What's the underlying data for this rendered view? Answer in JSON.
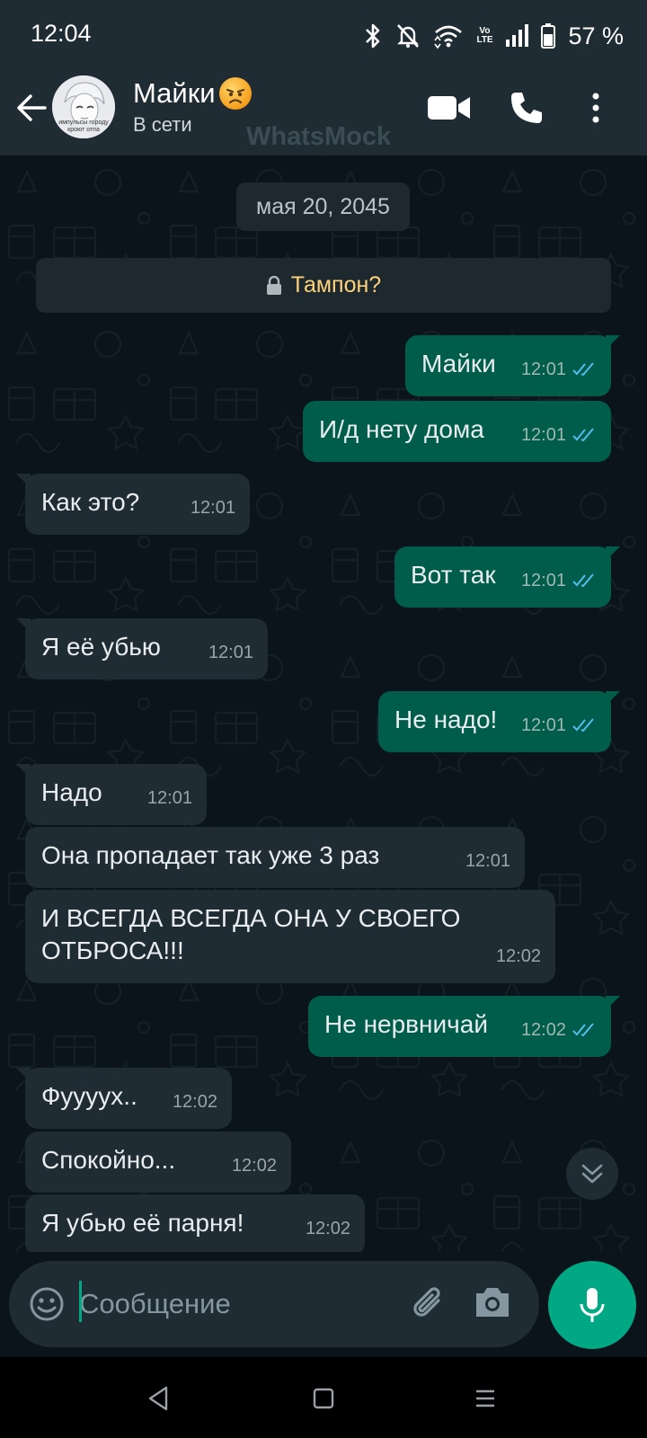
{
  "status_bar": {
    "time": "12:04",
    "lte_label": "Vo LTE",
    "battery": "57 %"
  },
  "header": {
    "contact_name": "Майки",
    "contact_emoji": "angry-face-emoji",
    "contact_status": "В сети",
    "watermark": "WhatsMock",
    "avatar_caption": "импульсы городу кроют отпа"
  },
  "chat": {
    "date": "мая 20, 2045",
    "encryption_note": "Тампон?",
    "messages": [
      {
        "dir": "out",
        "text": "Майки",
        "time": "12:01",
        "status": "read"
      },
      {
        "dir": "out",
        "text": "И/д нету дома",
        "time": "12:01",
        "status": "read"
      },
      {
        "dir": "in",
        "text": "Как это?",
        "time": "12:01"
      },
      {
        "dir": "out",
        "text": "Вот так",
        "time": "12:01",
        "status": "read"
      },
      {
        "dir": "in",
        "text": "Я её убью",
        "time": "12:01"
      },
      {
        "dir": "out",
        "text": "Не надо!",
        "time": "12:01",
        "status": "read"
      },
      {
        "dir": "in",
        "text": "Надо",
        "time": "12:01"
      },
      {
        "dir": "in",
        "text": "Она пропадает так уже 3 раз",
        "time": "12:01"
      },
      {
        "dir": "in",
        "text": "И ВСЕГДА ВСЕГДА ОНА У СВОЕГО",
        "text2": "ОТБРОСА!!!",
        "time": "12:02"
      },
      {
        "dir": "out",
        "text": "Не нервничай",
        "time": "12:02",
        "status": "read"
      },
      {
        "dir": "in",
        "text": "Фуууух..",
        "time": "12:02"
      },
      {
        "dir": "in",
        "text": "Спокойно...",
        "time": "12:02"
      },
      {
        "dir": "in",
        "text": "Я убью её парня!",
        "time": "12:02"
      }
    ]
  },
  "input": {
    "placeholder": "Сообщение",
    "value": ""
  },
  "colors": {
    "outgoing_bubble": "#005c4b",
    "incoming_bubble": "#1f2c34",
    "accent": "#00a884",
    "read_ticks": "#53bdeb",
    "background": "#0b141a"
  }
}
